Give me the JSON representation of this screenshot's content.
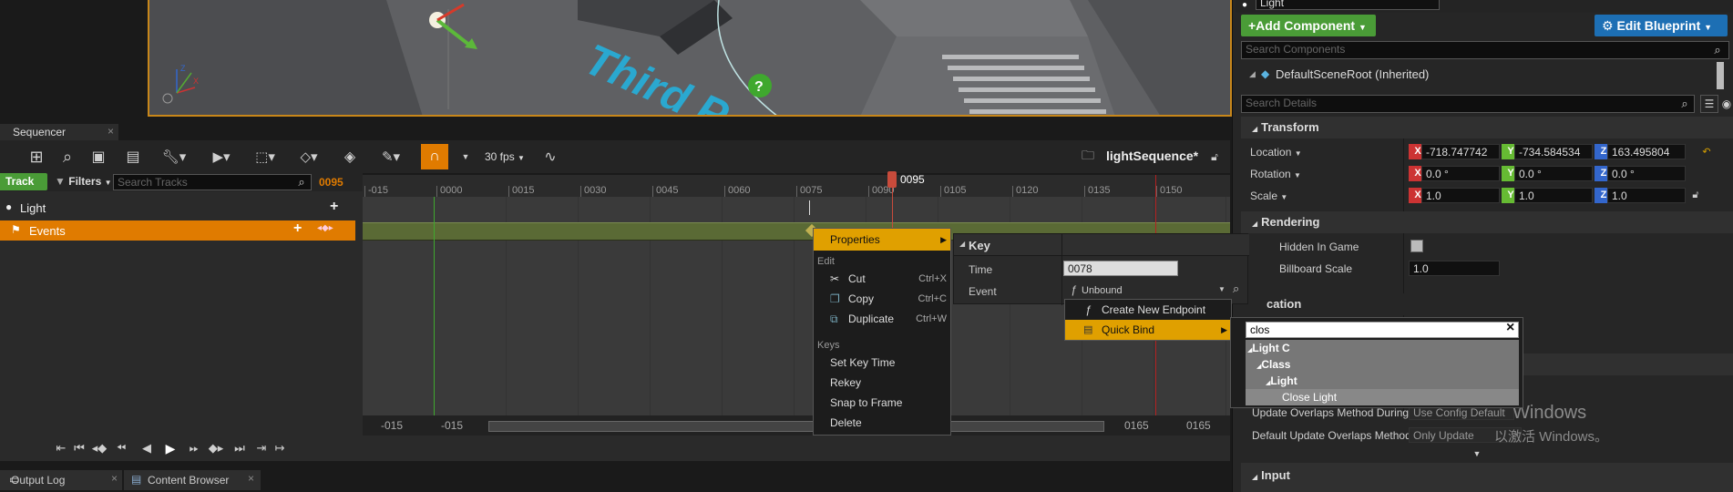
{
  "colors": {
    "accent": "#e0a000",
    "add_component": "#4a9c37",
    "edit_blueprint": "#1d6fb4",
    "playhead": "#c84b3b",
    "axis_x": "#c33",
    "axis_y": "#6b3",
    "axis_z": "#36c"
  },
  "details_header": {
    "name_value": "Light",
    "add_component_label": "+Add Component",
    "edit_blueprint_label": "Edit Blueprint",
    "search_components_placeholder": "Search Components",
    "default_scene_root": "DefaultSceneRoot (Inherited)",
    "search_details_placeholder": "Search Details"
  },
  "transform": {
    "section": "Transform",
    "location_label": "Location",
    "rotation_label": "Rotation",
    "scale_label": "Scale",
    "location": [
      "-718.747742",
      "-734.584534",
      "163.495804"
    ],
    "rotation": [
      "0.0 °",
      "0.0 °",
      "0.0 °"
    ],
    "scale": [
      "1.0",
      "1.0",
      "1.0"
    ],
    "axis_labels": [
      "X",
      "Y",
      "Z"
    ]
  },
  "rendering": {
    "section": "Rendering",
    "hidden_in_game": "Hidden In Game",
    "billboard_scale": "Billboard Scale",
    "billboard_value": "1.0",
    "location_partial": "cation"
  },
  "overlaps": {
    "update_during": "Update Overlaps Method During L",
    "update_during_value": "Use Config Default",
    "default_update": "Default Update Overlaps Method",
    "default_update_value": "Only Update Movable"
  },
  "input_section": "Input",
  "watermark": {
    "line1": "Windows",
    "line2": "以激活 Windows。"
  },
  "sequencer": {
    "tab": "Sequencer",
    "fps": "30 fps",
    "sequence_name": "lightSequence*",
    "track_button": "Track",
    "filters_button": "Filters",
    "search_tracks_placeholder": "Search Tracks",
    "current_frame": "0095",
    "tracks": [
      {
        "label": "Light"
      },
      {
        "label": "Events"
      }
    ],
    "playhead_label": "0095",
    "ticks": [
      "-015",
      "0000",
      "0015",
      "0030",
      "0045",
      "0060",
      "0075",
      "0090",
      "0105",
      "0120",
      "0135",
      "0150"
    ],
    "range": {
      "left_outer": "-015",
      "left_inner": "-015",
      "right_inner": "0165",
      "right_outer": "0165"
    }
  },
  "context_menu": {
    "properties": "Properties",
    "edit_header": "Edit",
    "cut": "Cut",
    "cut_shortcut": "Ctrl+X",
    "copy": "Copy",
    "copy_shortcut": "Ctrl+C",
    "duplicate": "Duplicate",
    "duplicate_shortcut": "Ctrl+W",
    "keys_header": "Keys",
    "set_key_time": "Set Key Time",
    "rekey": "Rekey",
    "snap_to_frame": "Snap to Frame",
    "delete": "Delete"
  },
  "key_panel": {
    "header": "Key",
    "time_label": "Time",
    "time_value": "0078",
    "event_label": "Event",
    "event_value": "Unbound"
  },
  "endpoint_menu": {
    "create_new_endpoint": "Create New Endpoint",
    "quick_bind": "Quick Bind"
  },
  "quickbind_popup": {
    "search_value": "clos",
    "tree": [
      {
        "label": "Light C",
        "level": 0
      },
      {
        "label": "Class",
        "level": 1
      },
      {
        "label": "Light",
        "level": 2
      },
      {
        "label": "Close Light",
        "level": 3
      }
    ]
  },
  "bottom_tabs": [
    {
      "label": "Output Log"
    },
    {
      "label": "Content Browser"
    }
  ],
  "viewport": {
    "text": "Third P"
  }
}
